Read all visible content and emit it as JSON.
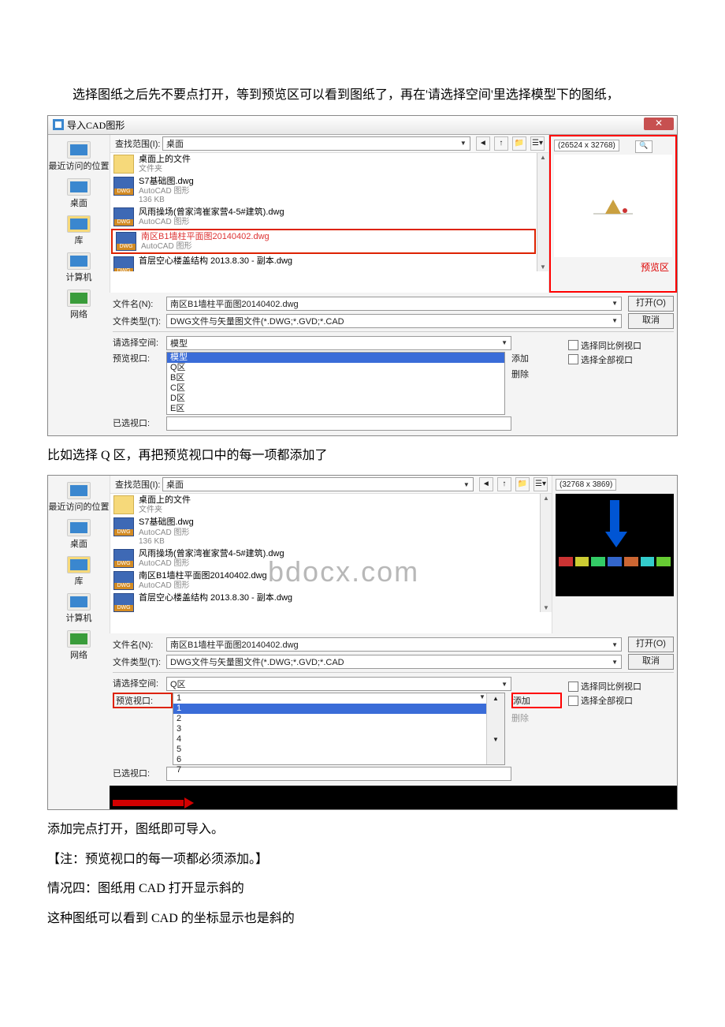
{
  "para1": "选择图纸之后先不要点打开，等到预览区可以看到图纸了，再在'请选择空间'里选择模型下的图纸，",
  "dlg1": {
    "title": "导入CAD图形",
    "range_label": "查找范围(I):",
    "range_value": "桌面",
    "sidebar": [
      "最近访问的位置",
      "桌面",
      "库",
      "计算机",
      "网络"
    ],
    "files": [
      {
        "main": "桌面上的文件",
        "sub": "文件夹",
        "kind": "folder"
      },
      {
        "main": "S7基础图.dwg",
        "sub": "AutoCAD 图形",
        "sub2": "136 KB",
        "kind": "dwg"
      },
      {
        "main": "风雨操场(曾家湾崔家营4-5#建筑).dwg",
        "sub": "AutoCAD 图形",
        "kind": "dwg"
      },
      {
        "main": "南区B1墙柱平面图20140402.dwg",
        "sub": "AutoCAD 图形",
        "kind": "dwg",
        "sel": true
      },
      {
        "main": "首层空心楼盖结构 2013.8.30 - 副本.dwg",
        "sub": "",
        "kind": "dwg"
      }
    ],
    "file_label": "文件名(N):",
    "file_value": "南区B1墙柱平面图20140402.dwg",
    "type_label": "文件类型(T):",
    "type_value": "DWG文件与矢量图文件(*.DWG;*.GVD;*.CAD",
    "open": "打开(O)",
    "cancel": "取消",
    "space_label": "请选择空间:",
    "space_value": "模型",
    "view_label": "预览视口:",
    "view_items": [
      "模型",
      "Q区",
      "B区",
      "C区",
      "D区",
      "E区"
    ],
    "sel_label": "已选视口:",
    "add": "添加",
    "del": "删除",
    "chk1": "选择同比例视口",
    "chk2": "选择全部视口",
    "dim": "(26524 x 32768)",
    "preview_label": "预览区"
  },
  "para2": "比如选择 Q 区，再把预览视口中的每一项都添加了",
  "dlg2": {
    "range_label": "查找范围(I):",
    "range_value": "桌面",
    "sidebar": [
      "最近访问的位置",
      "桌面",
      "库",
      "计算机",
      "网络"
    ],
    "files": [
      {
        "main": "桌面上的文件",
        "sub": "文件夹",
        "kind": "folder"
      },
      {
        "main": "S7基础图.dwg",
        "sub": "AutoCAD 图形",
        "sub2": "136 KB",
        "kind": "dwg"
      },
      {
        "main": "风雨操场(曾家湾崔家营4-5#建筑).dwg",
        "sub": "AutoCAD 图形",
        "kind": "dwg"
      },
      {
        "main": "南区B1墙柱平面图20140402.dwg",
        "sub": "AutoCAD 图形",
        "kind": "dwg"
      },
      {
        "main": "首层空心楼盖结构 2013.8.30 - 副本.dwg",
        "sub": "",
        "kind": "dwg"
      }
    ],
    "file_label": "文件名(N):",
    "file_value": "南区B1墙柱平面图20140402.dwg",
    "type_label": "文件类型(T):",
    "type_value": "DWG文件与矢量图文件(*.DWG;*.GVD;*.CAD",
    "open": "打开(O)",
    "cancel": "取消",
    "space_label": "请选择空间:",
    "space_value": "Q区",
    "view_label": "预览视口:",
    "view_items": [
      "1",
      "1",
      "2",
      "3",
      "4",
      "5",
      "6",
      "7"
    ],
    "sel_label": "已选视口:",
    "add": "添加",
    "del": "删除",
    "chk1": "选择同比例视口",
    "chk2": "选择全部视口",
    "dim": "(32768 x 3869)",
    "watermark": "bdocx.com"
  },
  "para3": "添加完点打开，图纸即可导入。",
  "para4": "【注：预览视口的每一项都必须添加。】",
  "para5": "情况四：图纸用 CAD 打开显示斜的",
  "para6": "这种图纸可以看到 CAD 的坐标显示也是斜的"
}
